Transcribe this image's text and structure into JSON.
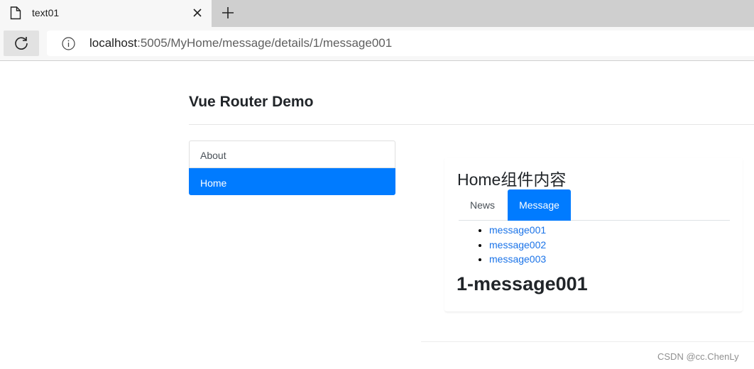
{
  "browser": {
    "tab_title": "text01",
    "url_host": "localhost",
    "url_rest": ":5005/MyHome/message/details/1/message001"
  },
  "app": {
    "title": "Vue Router Demo",
    "nav": [
      {
        "label": "About",
        "active": false
      },
      {
        "label": "Home",
        "active": true
      }
    ]
  },
  "home": {
    "heading": "Home组件内容",
    "tabs": [
      {
        "label": "News",
        "active": false
      },
      {
        "label": "Message",
        "active": true
      }
    ],
    "messages": [
      "message001",
      "message002",
      "message003"
    ],
    "detail": "1-message001"
  },
  "watermark": "CSDN @cc.ChenLy",
  "colors": {
    "accent": "#007bff",
    "link": "#1a73e8"
  }
}
